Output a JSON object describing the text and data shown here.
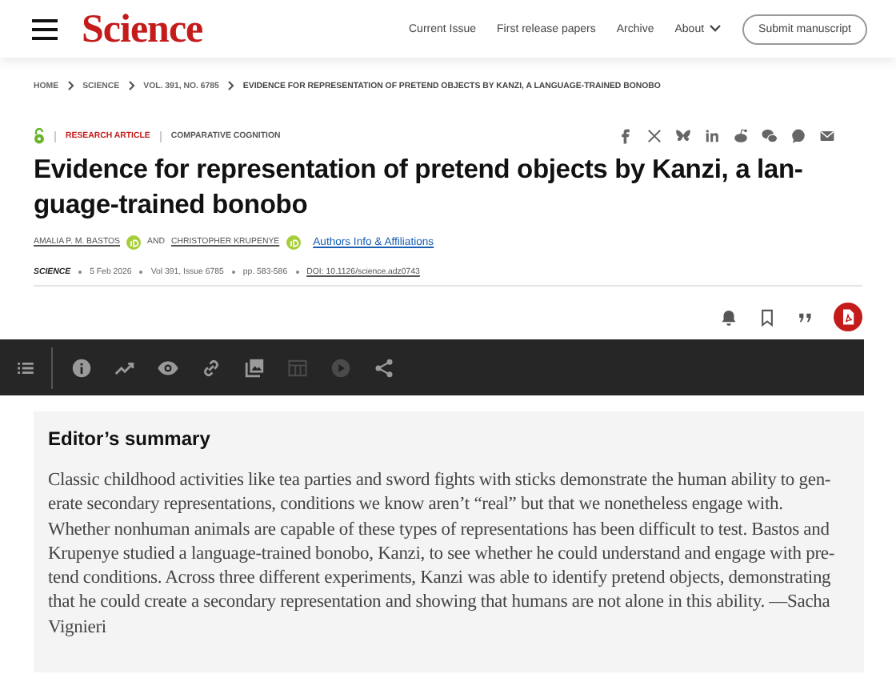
{
  "header": {
    "logo": "Science",
    "nav": [
      {
        "label": "Current Issue",
        "dropdown": false
      },
      {
        "label": "First release papers",
        "dropdown": false
      },
      {
        "label": "Archive",
        "dropdown": false
      },
      {
        "label": "About",
        "dropdown": true
      }
    ],
    "button": "Submit manuscript"
  },
  "breadcrumbs": [
    "HOME",
    "SCIENCE",
    "VOL. 391, NO. 6785",
    "EVIDENCE FOR REPRESENTATION OF PRETEND OBJECTS BY KANZI, A LANGUAGE-TRAINED BONOBO"
  ],
  "article": {
    "open_access": true,
    "type": "RESEARCH ARTICLE",
    "subject": "COMPARATIVE COGNITION",
    "title": "Evidence for representation of pretend objects by Kanzi, a lan-\nguage-trained bonobo",
    "share": [
      {
        "kind": "facebook"
      },
      {
        "kind": "x"
      },
      {
        "kind": "bluesky"
      },
      {
        "kind": "linkedin"
      },
      {
        "kind": "reddit"
      },
      {
        "kind": "wechat"
      },
      {
        "kind": "whatsapp"
      },
      {
        "kind": "mail"
      }
    ],
    "authors": [
      {
        "name": "AMALIA P. M. BASTOS",
        "orcid": true
      },
      {
        "joiner": "AND"
      },
      {
        "name": "CHRISTOPHER KRUPENYE",
        "orcid": true
      }
    ],
    "affiliations_link": "Authors Info & Affiliations",
    "journal": "SCIENCE",
    "date": "5 Feb 2026",
    "volume": "Vol 391, Issue 6785",
    "pages": "pp. 583-586",
    "doi": "DOI: 10.1126/science.adz0743",
    "actions": [
      {
        "kind": "bell"
      },
      {
        "kind": "bookmark"
      },
      {
        "kind": "quote"
      },
      {
        "kind": "pdf"
      }
    ]
  },
  "toolbar": [
    {
      "kind": "list",
      "disabled": false
    },
    {
      "kind": "info",
      "disabled": false
    },
    {
      "kind": "trend",
      "disabled": false
    },
    {
      "kind": "eye",
      "disabled": false
    },
    {
      "kind": "link",
      "disabled": false
    },
    {
      "kind": "images",
      "disabled": false
    },
    {
      "kind": "table",
      "disabled": true
    },
    {
      "kind": "play",
      "disabled": true
    },
    {
      "kind": "share",
      "disabled": false
    }
  ],
  "summary": {
    "heading": "Editor’s summary",
    "text": "Classic childhood activities like tea parties and sword fights with sticks demonstrate the human ability to gen-\nerate secondary representations, conditions we know aren’t “real” but that we nonetheless engage with.\nWhether nonhuman animals are capable of these types of representations has been difficult to test. Bastos and\nKrupenye studied a language-trained bonobo, Kanzi, to see whether he could understand and engage with pre-\ntend conditions. Across three different experiments, Kanzi was able to identify pretend objects, demonstrating\nthat he could create a secondary representation and showing that humans are not alone in this ability. —Sacha\nVignieri"
  }
}
